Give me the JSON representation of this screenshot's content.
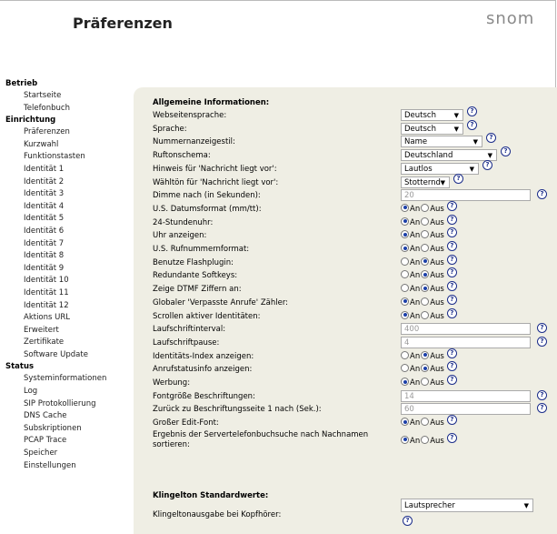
{
  "header": {
    "title": "Präferenzen",
    "logo": "snom"
  },
  "sidebar": [
    {
      "type": "section",
      "label": "Betrieb"
    },
    {
      "type": "item",
      "label": "Startseite"
    },
    {
      "type": "item",
      "label": "Telefonbuch"
    },
    {
      "type": "section",
      "label": "Einrichtung"
    },
    {
      "type": "item",
      "label": "Präferenzen"
    },
    {
      "type": "item",
      "label": "Kurzwahl"
    },
    {
      "type": "item",
      "label": "Funktionstasten"
    },
    {
      "type": "item",
      "label": "Identität 1"
    },
    {
      "type": "item",
      "label": "Identität 2"
    },
    {
      "type": "item",
      "label": "Identität 3"
    },
    {
      "type": "item",
      "label": "Identität 4"
    },
    {
      "type": "item",
      "label": "Identität 5"
    },
    {
      "type": "item",
      "label": "Identität 6"
    },
    {
      "type": "item",
      "label": "Identität 7"
    },
    {
      "type": "item",
      "label": "Identität 8"
    },
    {
      "type": "item",
      "label": "Identität 9"
    },
    {
      "type": "item",
      "label": "Identität 10"
    },
    {
      "type": "item",
      "label": "Identität 11"
    },
    {
      "type": "item",
      "label": "Identität 12"
    },
    {
      "type": "item",
      "label": "Aktions URL"
    },
    {
      "type": "item",
      "label": "Erweitert"
    },
    {
      "type": "item",
      "label": "Zertifikate"
    },
    {
      "type": "item",
      "label": "Software Update"
    },
    {
      "type": "section",
      "label": "Status"
    },
    {
      "type": "item",
      "label": "Systeminformationen"
    },
    {
      "type": "item",
      "label": "Log"
    },
    {
      "type": "item",
      "label": "SIP Protokollierung"
    },
    {
      "type": "item",
      "label": "DNS Cache"
    },
    {
      "type": "item",
      "label": "Subskriptionen"
    },
    {
      "type": "item",
      "label": "PCAP Trace"
    },
    {
      "type": "item",
      "label": "Speicher"
    },
    {
      "type": "item",
      "label": "Einstellungen"
    }
  ],
  "section1": "Allgemeine Informationen:",
  "section2": "Klingelton Standardwerte:",
  "radio_on": "An",
  "radio_off": "Aus",
  "help": "?",
  "rows": [
    {
      "label": "Webseitensprache:",
      "type": "select",
      "value": "Deutsch",
      "w": 69
    },
    {
      "label": "Sprache:",
      "type": "select",
      "value": "Deutsch",
      "w": 69
    },
    {
      "label": "Nummernanzeigestil:",
      "type": "select",
      "value": "Name",
      "w": 90
    },
    {
      "label": "Ruftonschema:",
      "type": "select",
      "value": "Deutschland",
      "w": 106
    },
    {
      "label": "Hinweis für 'Nachricht liegt vor':",
      "type": "select",
      "value": "Lautlos",
      "w": 86
    },
    {
      "label": "Wähltön für 'Nachricht liegt vor':",
      "type": "select",
      "value": "Stotternd",
      "w": 54
    },
    {
      "label": "Dimme nach (in Sekunden):",
      "type": "input",
      "value": "20"
    },
    {
      "label": "U.S. Datumsformat (mm/tt):",
      "type": "radio",
      "on": true
    },
    {
      "label": "24-Stundenuhr:",
      "type": "radio",
      "on": true
    },
    {
      "label": "Uhr anzeigen:",
      "type": "radio",
      "on": true
    },
    {
      "label": "U.S. Rufnummernformat:",
      "type": "radio",
      "on": true
    },
    {
      "label": "Benutze Flashplugin:",
      "type": "radio",
      "on": false
    },
    {
      "label": "Redundante Softkeys:",
      "type": "radio",
      "on": false
    },
    {
      "label": "Zeige DTMF Ziffern an:",
      "type": "radio",
      "on": false
    },
    {
      "label": "Globaler 'Verpasste Anrufe' Zähler:",
      "type": "radio",
      "on": true
    },
    {
      "label": "Scrollen aktiver Identitäten:",
      "type": "radio",
      "on": true
    },
    {
      "label": "Laufschriftinterval:",
      "type": "input",
      "value": "400"
    },
    {
      "label": "Laufschriftpause:",
      "type": "input",
      "value": "4"
    },
    {
      "label": "Identitäts-Index anzeigen:",
      "type": "radio",
      "on": false
    },
    {
      "label": "Anrufstatusinfo anzeigen:",
      "type": "radio",
      "on": false
    },
    {
      "label": "Werbung:",
      "type": "radio",
      "on": true
    },
    {
      "label": "Fontgröße Beschriftungen:",
      "type": "input",
      "value": "14"
    },
    {
      "label": "Zurück zu Beschriftungsseite 1 nach (Sek.):",
      "type": "input",
      "value": "60"
    },
    {
      "label": "Großer Edit-Font:",
      "type": "radio",
      "on": true
    },
    {
      "label": "Ergebnis der Servertelefonbuchsuche nach Nachnamen sortieren:",
      "type": "radio",
      "on": true,
      "two": true
    }
  ],
  "ringer": {
    "label": "Klingeltonausgabe bei Kopfhörer:",
    "value": "Lautsprecher"
  }
}
